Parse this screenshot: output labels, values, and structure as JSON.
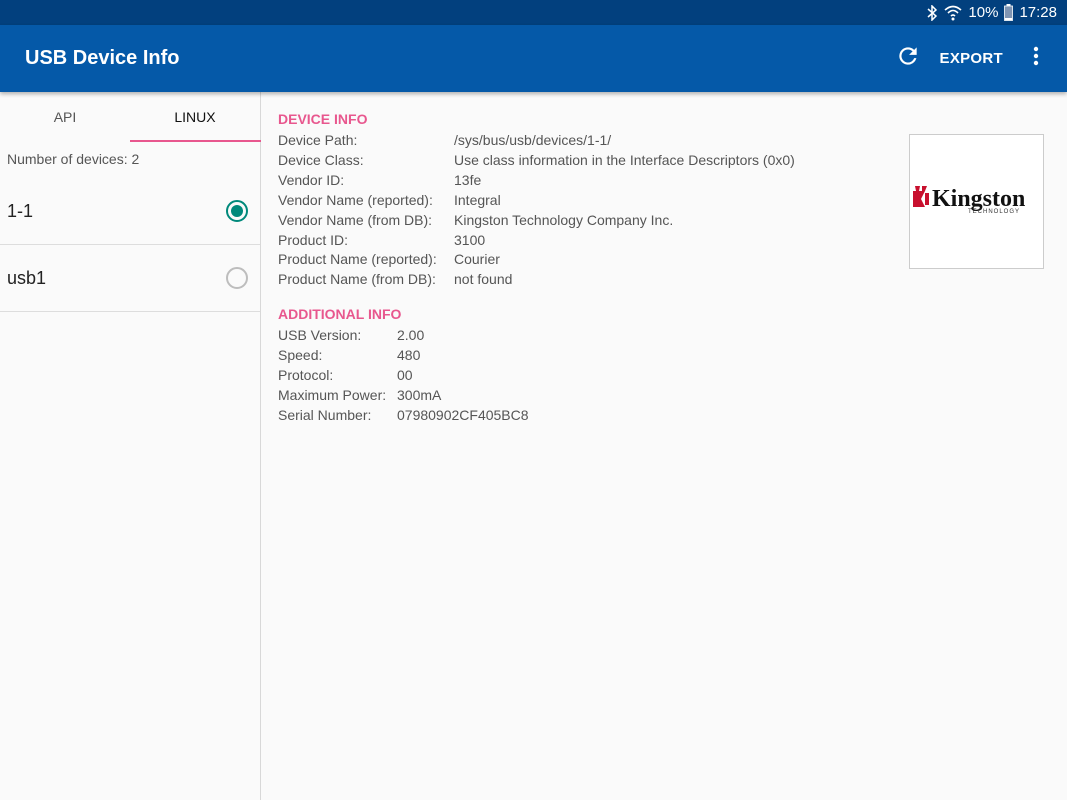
{
  "status_bar": {
    "battery": "10%",
    "time": "17:28"
  },
  "app_bar": {
    "title": "USB Device Info",
    "export_label": "EXPORT"
  },
  "tabs": [
    {
      "label": "API"
    },
    {
      "label": "LINUX"
    }
  ],
  "device_list": {
    "count_text": "Number of devices: 2",
    "devices": [
      {
        "label": "1-1",
        "selected": true
      },
      {
        "label": "usb1",
        "selected": false
      }
    ]
  },
  "device_info": {
    "title": "DEVICE INFO",
    "rows": [
      {
        "key": "Device Path:",
        "value": "/sys/bus/usb/devices/1-1/"
      },
      {
        "key": "Device Class:",
        "value": "Use class information in the Interface Descriptors (0x0)"
      },
      {
        "key": "Vendor ID:",
        "value": "13fe"
      },
      {
        "key": "Vendor Name (reported):",
        "value": "Integral"
      },
      {
        "key": "Vendor Name (from DB):",
        "value": "Kingston Technology Company Inc."
      },
      {
        "key": "Product ID:",
        "value": "3100"
      },
      {
        "key": "Product Name (reported):",
        "value": "Courier"
      },
      {
        "key": "Product Name (from DB):",
        "value": "not found"
      }
    ]
  },
  "additional_info": {
    "title": "ADDITIONAL INFO",
    "rows": [
      {
        "key": "USB Version:",
        "value": "2.00"
      },
      {
        "key": "Speed:",
        "value": "480"
      },
      {
        "key": "Protocol:",
        "value": "00"
      },
      {
        "key": "Maximum Power:",
        "value": "300mA"
      },
      {
        "key": "Serial Number:",
        "value": "07980902CF405BC8"
      }
    ]
  },
  "vendor_logo": {
    "text": "Kingston",
    "subtext": "TECHNOLOGY"
  },
  "colors": {
    "status_bar": "#02407e",
    "app_bar": "#0559a8",
    "accent": "#e8578e",
    "radio": "#00897b"
  }
}
